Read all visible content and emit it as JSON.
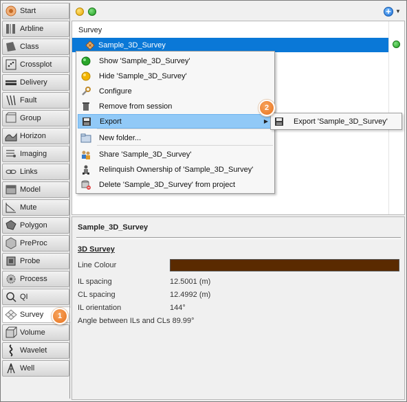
{
  "sidebar": {
    "items": [
      {
        "label": "Start",
        "icon": "start-icon"
      },
      {
        "label": "Arbline",
        "icon": "arbline-icon"
      },
      {
        "label": "Class",
        "icon": "class-icon"
      },
      {
        "label": "Crossplot",
        "icon": "crossplot-icon"
      },
      {
        "label": "Delivery",
        "icon": "delivery-icon"
      },
      {
        "label": "Fault",
        "icon": "fault-icon"
      },
      {
        "label": "Group",
        "icon": "group-icon"
      },
      {
        "label": "Horizon",
        "icon": "horizon-icon"
      },
      {
        "label": "Imaging",
        "icon": "imaging-icon"
      },
      {
        "label": "Links",
        "icon": "links-icon"
      },
      {
        "label": "Model",
        "icon": "model-icon"
      },
      {
        "label": "Mute",
        "icon": "mute-icon"
      },
      {
        "label": "Polygon",
        "icon": "polygon-icon"
      },
      {
        "label": "PreProc",
        "icon": "preproc-icon"
      },
      {
        "label": "Probe",
        "icon": "probe-icon"
      },
      {
        "label": "Process",
        "icon": "process-icon"
      },
      {
        "label": "QI",
        "icon": "qi-icon"
      },
      {
        "label": "Survey",
        "icon": "survey-icon",
        "active": true
      },
      {
        "label": "Volume",
        "icon": "volume-icon"
      },
      {
        "label": "Wavelet",
        "icon": "wavelet-icon"
      },
      {
        "label": "Well",
        "icon": "well-icon"
      }
    ]
  },
  "topbar": {
    "add_symbol": "+",
    "dropdown_symbol": "▼"
  },
  "tree": {
    "header": "Survey",
    "selected_item": "Sample_3D_Survey"
  },
  "context_menu": {
    "items": [
      {
        "label": "Show 'Sample_3D_Survey'",
        "icon": "green-status-icon"
      },
      {
        "label": "Hide 'Sample_3D_Survey'",
        "icon": "yellow-status-icon"
      },
      {
        "label": "Configure",
        "icon": "wrench-icon"
      },
      {
        "label": "Remove from session",
        "icon": "trash-icon"
      },
      {
        "label": "Export",
        "icon": "floppy-disk-icon",
        "highlight": true,
        "submenu_arrow": "▶"
      },
      {
        "label": "New folder...",
        "icon": "folder-icon"
      },
      {
        "label": "Share 'Sample_3D_Survey'",
        "icon": "users-icon"
      },
      {
        "label": "Relinquish Ownership of 'Sample_3D_Survey'",
        "icon": "user-release-icon"
      },
      {
        "label": "Delete 'Sample_3D_Survey' from project",
        "icon": "database-delete-icon"
      }
    ]
  },
  "submenu": {
    "items": [
      {
        "label": "Export 'Sample_3D_Survey'",
        "icon": "floppy-disk-icon"
      }
    ]
  },
  "callouts": [
    {
      "number": "1"
    },
    {
      "number": "2"
    }
  ],
  "properties": {
    "title": "Sample_3D_Survey",
    "section": "3D Survey",
    "line_colour_label": "Line Colour",
    "line_colour": "#5a2a00",
    "rows": [
      {
        "label": "IL spacing",
        "value": "12.5001 (m)"
      },
      {
        "label": "CL spacing",
        "value": "12.4992 (m)"
      },
      {
        "label": "IL orientation",
        "value": "144°"
      },
      {
        "label": "Angle between ILs and CLs",
        "value": "89.99°"
      }
    ]
  },
  "colors": {
    "selection": "#0a78d7",
    "menu_highlight": "#91c9f7",
    "callout": "#e8731e"
  }
}
